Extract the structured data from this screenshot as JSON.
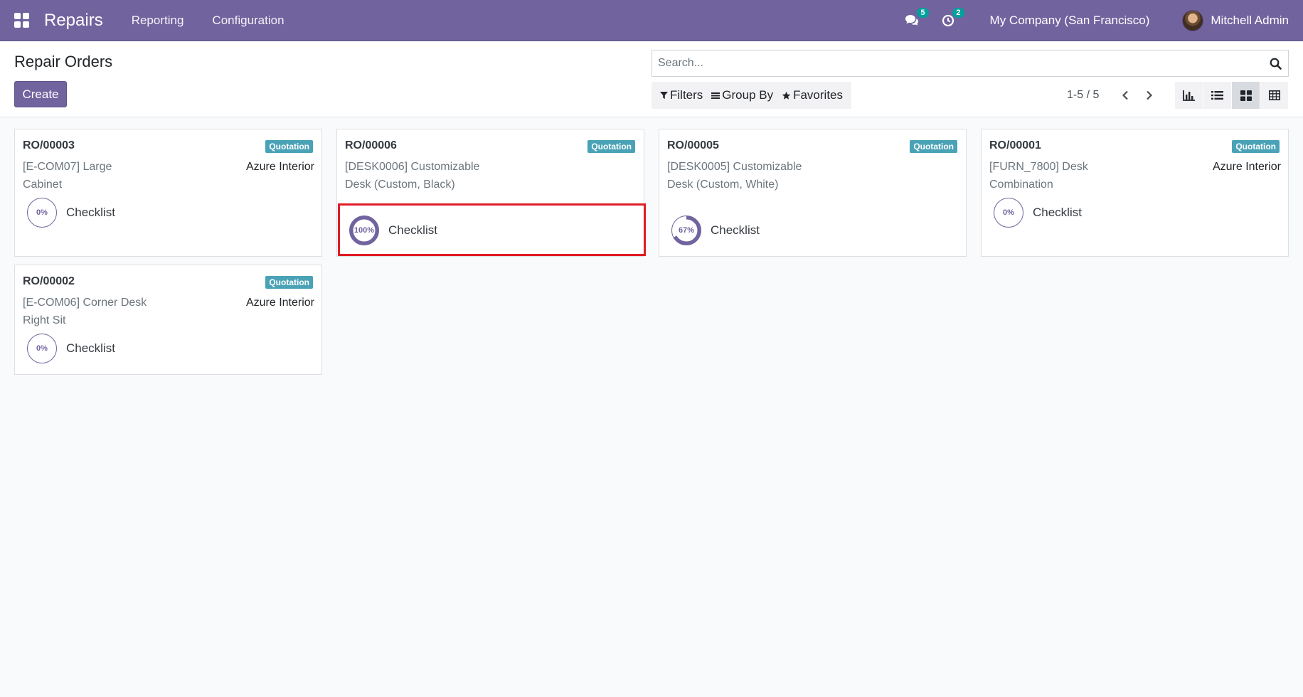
{
  "navbar": {
    "app_name": "Repairs",
    "menu": [
      "Reporting",
      "Configuration"
    ],
    "messages_count": "5",
    "activities_count": "2",
    "company": "My Company (San Francisco)",
    "user": "Mitchell Admin",
    "color": "#71639e"
  },
  "control_panel": {
    "title": "Repair Orders",
    "create_label": "Create",
    "search_placeholder": "Search...",
    "filters_label": "Filters",
    "group_by_label": "Group By",
    "favorites_label": "Favorites",
    "pager": "1-5 / 5",
    "views": [
      "graph-icon",
      "list-icon",
      "kanban-icon",
      "pivot-icon"
    ],
    "active_view": "kanban"
  },
  "cards": [
    {
      "ref": "RO/00003",
      "status": "Quotation",
      "product": "[E-COM07] Large Cabinet",
      "customer": "Azure Interior",
      "progress": 0,
      "progress_label": "0%",
      "checklist": "Checklist"
    },
    {
      "ref": "RO/00006",
      "status": "Quotation",
      "product": "[DESK0006] Customizable Desk (Custom, Black)",
      "customer": "",
      "progress": 100,
      "progress_label": "100%",
      "checklist": "Checklist"
    },
    {
      "ref": "RO/00005",
      "status": "Quotation",
      "product": "[DESK0005] Customizable Desk (Custom, White)",
      "customer": "",
      "progress": 67,
      "progress_label": "67%",
      "checklist": "Checklist"
    },
    {
      "ref": "RO/00001",
      "status": "Quotation",
      "product": "[FURN_7800] Desk Combination",
      "customer": "Azure Interior",
      "progress": 0,
      "progress_label": "0%",
      "checklist": "Checklist"
    },
    {
      "ref": "RO/00002",
      "status": "Quotation",
      "product": "[E-COM06] Corner Desk Right Sit",
      "customer": "Azure Interior",
      "progress": 0,
      "progress_label": "0%",
      "checklist": "Checklist"
    }
  ],
  "colors": {
    "badge": "#4aa2b7",
    "ring": "#71639e",
    "highlight": "#e01b24"
  }
}
